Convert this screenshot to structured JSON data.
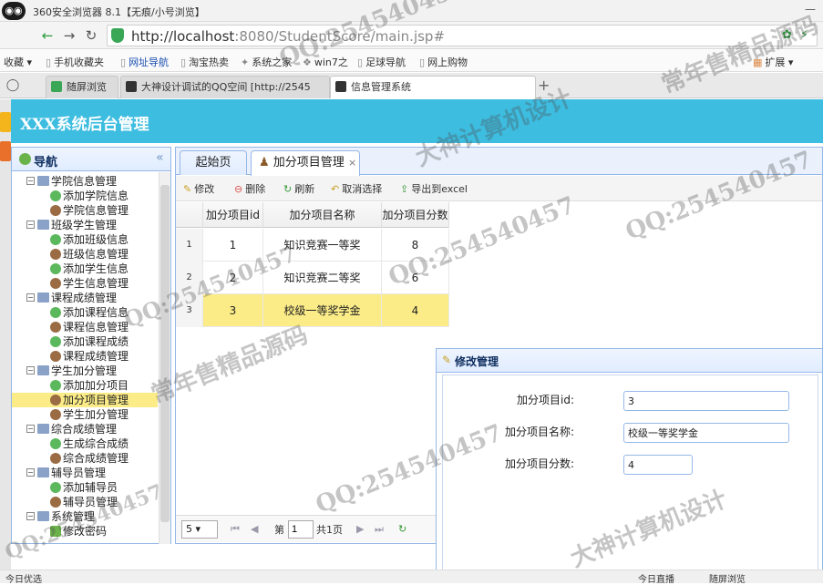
{
  "browser": {
    "title": "360安全浏览器 8.1【无痕/小号浏览】",
    "url_host": "http://localhost",
    "url_rest": ":8080/StudentScore/main.jsp#",
    "bookmarks": [
      "收藏",
      "手机收藏夹",
      "网址导航",
      "淘宝热卖",
      "系统之家",
      "win7之",
      "足球导航",
      "网上购物"
    ],
    "extensions_label": "扩展",
    "tabs": [
      "随屏浏览",
      "大神设计调试的QQ空间 [http://2545",
      "信息管理系统"
    ]
  },
  "app": {
    "header_title": "XXX系统后台管理",
    "nav_title": "导航",
    "tree": [
      {
        "label": "学院信息管理",
        "level": 0
      },
      {
        "label": "添加学院信息",
        "level": 1,
        "icon": "add"
      },
      {
        "label": "学院信息管理",
        "level": 1,
        "icon": "user"
      },
      {
        "label": "班级学生管理",
        "level": 0
      },
      {
        "label": "添加班级信息",
        "level": 1,
        "icon": "add"
      },
      {
        "label": "班级信息管理",
        "level": 1,
        "icon": "user"
      },
      {
        "label": "添加学生信息",
        "level": 1,
        "icon": "add"
      },
      {
        "label": "学生信息管理",
        "level": 1,
        "icon": "user"
      },
      {
        "label": "课程成绩管理",
        "level": 0
      },
      {
        "label": "添加课程信息",
        "level": 1,
        "icon": "add"
      },
      {
        "label": "课程信息管理",
        "level": 1,
        "icon": "user"
      },
      {
        "label": "添加课程成绩",
        "level": 1,
        "icon": "add"
      },
      {
        "label": "课程成绩管理",
        "level": 1,
        "icon": "user"
      },
      {
        "label": "学生加分管理",
        "level": 0
      },
      {
        "label": "添加加分项目",
        "level": 1,
        "icon": "add"
      },
      {
        "label": "加分项目管理",
        "level": 1,
        "icon": "user",
        "selected": true
      },
      {
        "label": "学生加分管理",
        "level": 1,
        "icon": "user"
      },
      {
        "label": "综合成绩管理",
        "level": 0
      },
      {
        "label": "生成综合成绩",
        "level": 1,
        "icon": "add"
      },
      {
        "label": "综合成绩管理",
        "level": 1,
        "icon": "user"
      },
      {
        "label": "辅导员管理",
        "level": 0
      },
      {
        "label": "添加辅导员",
        "level": 1,
        "icon": "add"
      },
      {
        "label": "辅导员管理",
        "level": 1,
        "icon": "user"
      },
      {
        "label": "系统管理",
        "level": 0
      },
      {
        "label": "修改密码",
        "level": 1,
        "icon": "edit"
      }
    ],
    "tabs": {
      "home": "起始页",
      "active": "加分项目管理",
      "close": "×"
    },
    "toolbar": {
      "edit": "修改",
      "delete": "删除",
      "refresh": "刷新",
      "deselect": "取消选择",
      "export": "导出到excel"
    },
    "grid": {
      "columns": [
        "加分项目id",
        "加分项目名称",
        "加分项目分数"
      ],
      "rows": [
        {
          "rn": "1",
          "id": "1",
          "name": "知识竞赛一等奖",
          "score": "8"
        },
        {
          "rn": "2",
          "id": "2",
          "name": "知识竞赛二等奖",
          "score": "6"
        },
        {
          "rn": "3",
          "id": "3",
          "name": "校级一等奖学金",
          "score": "4"
        }
      ],
      "selected_row": 3
    },
    "pager": {
      "page_size": "5",
      "page_label_pre": "第",
      "page": "1",
      "page_label_post": "共1页"
    },
    "edit": {
      "title": "修改管理",
      "fields": [
        {
          "label": "加分项目id:",
          "value": "3"
        },
        {
          "label": "加分项目名称:",
          "value": "校级一等奖学金"
        },
        {
          "label": "加分项目分数:",
          "value": "4"
        }
      ]
    }
  },
  "status": {
    "left": "今日优选",
    "right1": "今日直播",
    "right2": "随屏浏览"
  },
  "watermarks": {
    "qq": "QQ:254540457",
    "t1": "大神计算机设计",
    "t2": "常年售精品源码"
  }
}
